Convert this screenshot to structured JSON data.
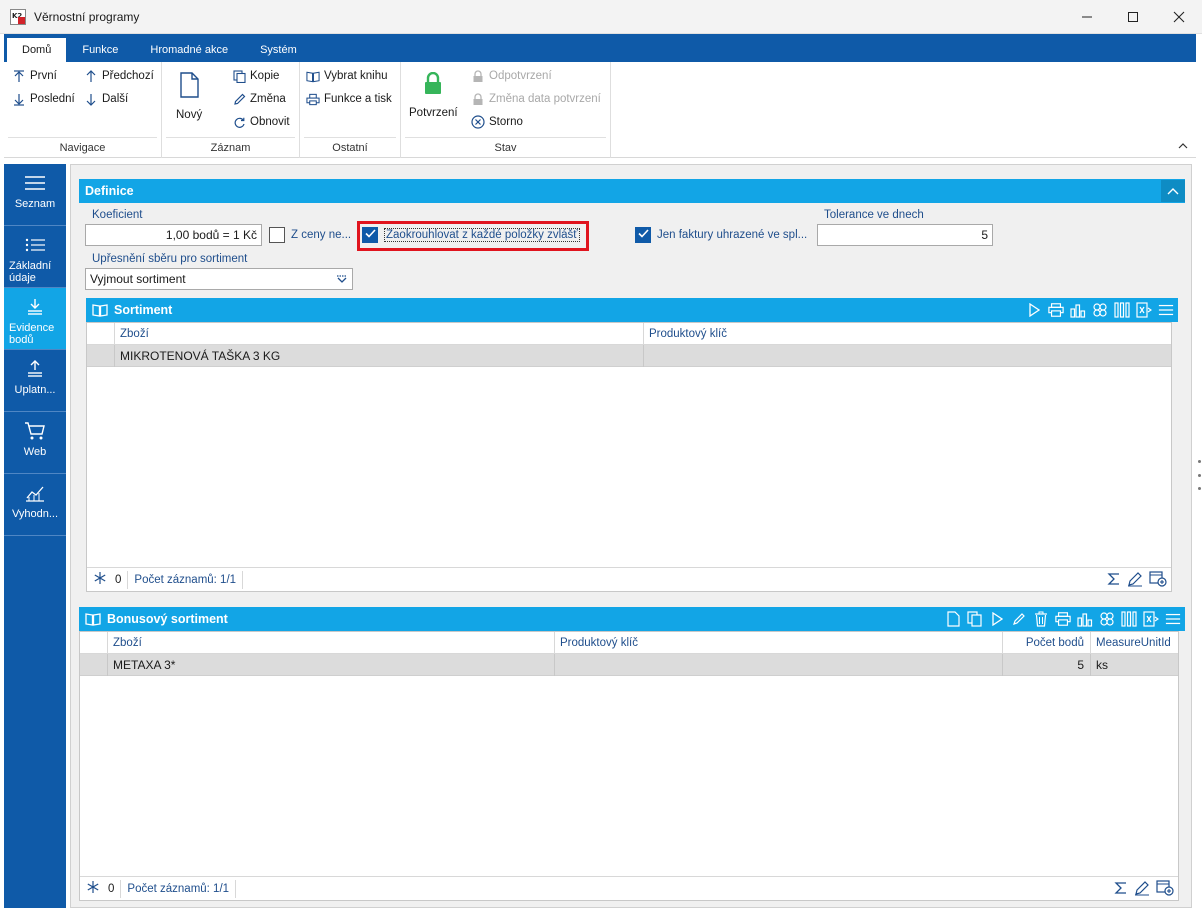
{
  "window": {
    "title": "Věrnostní programy",
    "controls": [
      "—",
      "☐",
      "✕"
    ]
  },
  "ribbon": {
    "tabs": [
      "Domů",
      "Funkce",
      "Hromadné akce",
      "Systém"
    ],
    "navigace": {
      "label": "Navigace",
      "first": "První",
      "previous": "Předchozí",
      "last": "Poslední",
      "next": "Další"
    },
    "zaznam": {
      "label": "Záznam",
      "new": "Nový",
      "copy": "Kopie",
      "change": "Změna",
      "refresh": "Obnovit"
    },
    "ostatni": {
      "label": "Ostatní",
      "choose_book": "Vybrat knihu",
      "functions_print": "Funkce a tisk"
    },
    "stav": {
      "label": "Stav",
      "confirm": "Potvrzení",
      "unconfirm": "Odpotvrzení",
      "change_confirm_date": "Změna data potvrzení",
      "cancel": "Storno"
    }
  },
  "sidebar": {
    "items": [
      {
        "label": "Seznam",
        "icon": "list-lines-icon"
      },
      {
        "label": "Základní údaje",
        "icon": "list-icon"
      },
      {
        "label": "Evidence bodů",
        "icon": "download-tray-icon",
        "active": true
      },
      {
        "label": "Uplatn...",
        "icon": "upload-tray-icon"
      },
      {
        "label": "Web",
        "icon": "cart-icon"
      },
      {
        "label": "Vyhodn...",
        "icon": "chart-icon"
      }
    ]
  },
  "definice": {
    "title": "Definice",
    "koeficient_label": "Koeficient",
    "koeficient_value": "1,00 bodů = 1 Kč",
    "z_ceny_label": "Z ceny ne...",
    "z_ceny_checked": false,
    "zaokrouhlovat_label": "Zaokrouhlovat z každé položky zvlášť",
    "zaokrouhlovat_checked": true,
    "jen_faktury_label": "Jen faktury uhrazené ve spl...",
    "jen_faktury_checked": true,
    "tolerance_label": "Tolerance ve dnech",
    "tolerance_value": "5",
    "upresneni_label": "Upřesnění sběru pro sortiment",
    "upresneni_value": "Vyjmout sortiment"
  },
  "sortiment": {
    "title": "Sortiment",
    "columns": [
      "Zboží",
      "Produktový klíč"
    ],
    "rows": [
      {
        "zbozi": "MIKROTENOVÁ TAŠKA 3 KG",
        "klic": ""
      }
    ],
    "footer_count": "0",
    "footer_records": "Počet záznamů: 1/1"
  },
  "bonusovy": {
    "title": "Bonusový sortiment",
    "columns": [
      "Zboží",
      "Produktový klíč",
      "Počet bodů",
      "MeasureUnitId"
    ],
    "rows": [
      {
        "zbozi": "METAXA 3*",
        "klic": "",
        "body": "5",
        "unit": "ks"
      }
    ],
    "footer_count": "0",
    "footer_records": "Počet záznamů: 1/1"
  },
  "colors": {
    "ribbon_blue": "#0f5aa8",
    "header_cyan": "#12a5e6",
    "highlight_red": "#e0141e",
    "label_blue": "#1f4e8c"
  }
}
